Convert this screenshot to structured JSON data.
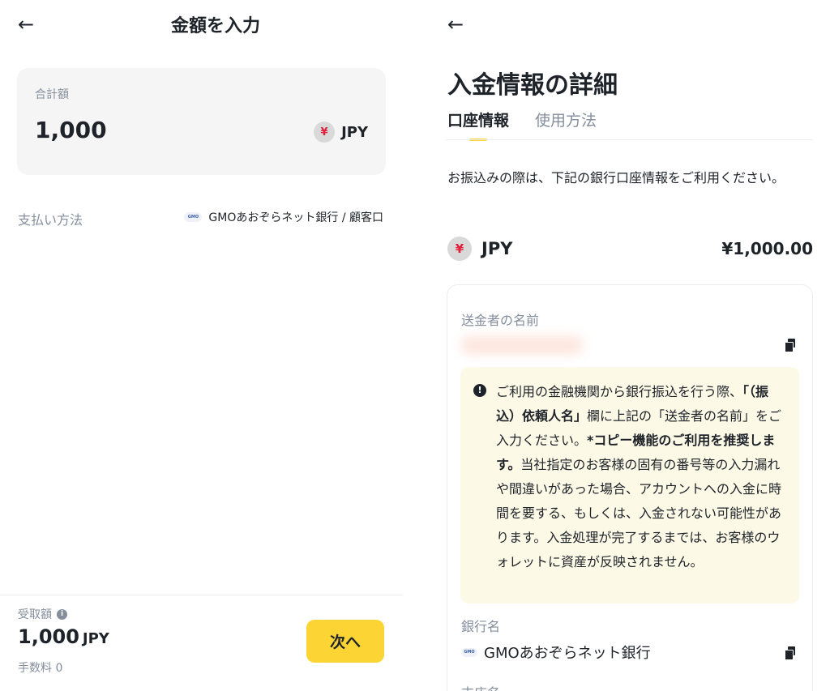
{
  "left": {
    "title": "金額を入力",
    "amount_label": "合計額",
    "amount_value": "1,000",
    "currency_symbol": "¥",
    "currency_code": "JPY",
    "payment_label": "支払い方法",
    "payment_logo_text": "GMO",
    "payment_value": "GMOあおぞらネット銀行 / 顧客口",
    "receive_label": "受取額",
    "receive_amount": "1,000",
    "receive_unit": "JPY",
    "fee_text": "手数料 0",
    "next_button": "次へ"
  },
  "right": {
    "title": "入金情報の詳細",
    "tabs": [
      {
        "label": "口座情報",
        "active": true
      },
      {
        "label": "使用方法",
        "active": false
      }
    ],
    "intro": "お振込みの際は、下記の銀行口座情報をご利用ください。",
    "currency_symbol": "¥",
    "currency_code": "JPY",
    "amount": "¥1,000.00",
    "sender_label": "送金者の名前",
    "notice": {
      "part1": "ご利用の金融機関から銀行振込を行う際、",
      "part2_bold": "「（振込）依頼人名」",
      "part3": "欄に上記の「送金者の名前」をご入力ください。",
      "part4_bold": "*コピー機能のご利用を推奨します。",
      "part5": "当社指定のお客様の固有の番号等の入力漏れや間違いがあった場合、アカウントへの入金に時間を要する、もしくは、入金されない可能性があります。入金処理が完了するまでは、お客様のウォレットに資産が反映されません。"
    },
    "bank_label": "銀行名",
    "bank_logo_text": "GMO",
    "bank_name": "GMOあおぞらネット銀行",
    "branch_label": "支店名"
  },
  "colors": {
    "accent": "#fcd535",
    "text": "#1e2329",
    "muted": "#848e9c",
    "notice_bg": "#fdf9e7",
    "yen_red": "#e0203a"
  },
  "icons": [
    "back-arrow-icon",
    "yen-coin-icon",
    "gmo-bank-logo",
    "info-icon",
    "copy-icon",
    "warning-icon"
  ]
}
